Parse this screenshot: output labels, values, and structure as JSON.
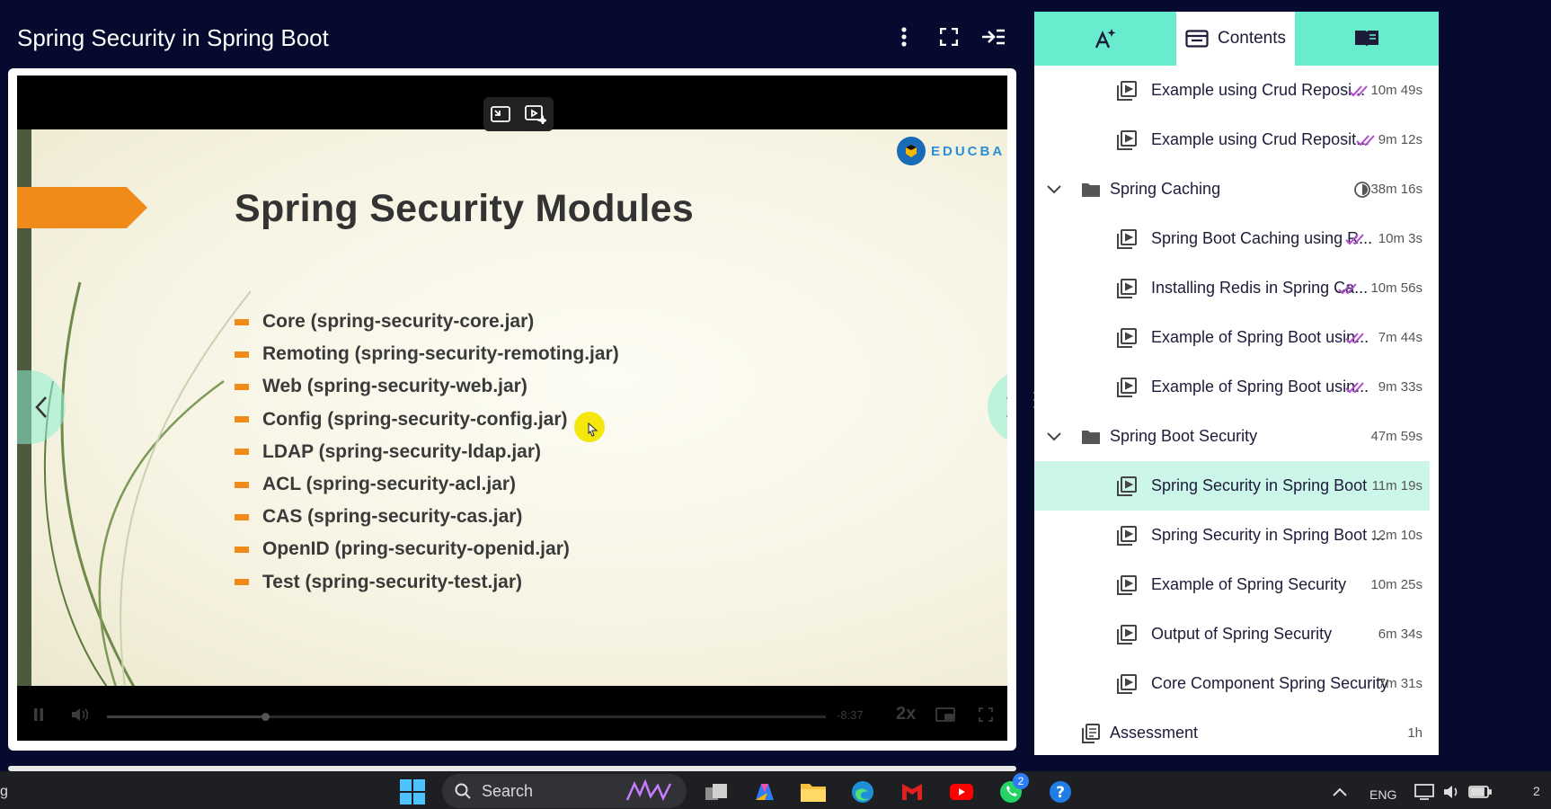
{
  "header": {
    "title": "Spring Security in Spring Boot"
  },
  "slide": {
    "heading": "Spring Security Modules",
    "logo_text": "EDUCBA",
    "modules": [
      "Core (spring-security-core.jar)",
      "Remoting (spring-security-remoting.jar)",
      "Web (spring-security-web.jar)",
      "Config (spring-security-config.jar)",
      "LDAP (spring-security-ldap.jar)",
      "ACL (spring-security-acl.jar)",
      "CAS (spring-security-cas.jar)",
      "OpenID (pring-security-openid.jar)",
      "Test (spring-security-test.jar)"
    ]
  },
  "player": {
    "time_remaining": "-8:37",
    "speed": "2x",
    "progress": 0.22
  },
  "sidebar": {
    "tabs": {
      "contents_label": "Contents"
    },
    "items": [
      {
        "type": "lesson",
        "label": "Example using Crud Reposi...",
        "duration": "10m 49s",
        "completed": true
      },
      {
        "type": "lesson",
        "label": "Example using Crud Reposit...",
        "duration": "9m 12s",
        "completed": true
      },
      {
        "type": "section",
        "label": "Spring Caching",
        "duration": "38m 16s",
        "partial": true
      },
      {
        "type": "lesson",
        "label": "Spring Boot Caching using R...",
        "duration": "10m 3s",
        "completed": true
      },
      {
        "type": "lesson",
        "label": "Installing Redis in Spring Ca...",
        "duration": "10m 56s",
        "completed": true
      },
      {
        "type": "lesson",
        "label": "Example of Spring Boot usin...",
        "duration": "7m 44s",
        "completed": true
      },
      {
        "type": "lesson",
        "label": "Example of Spring Boot usin...",
        "duration": "9m 33s",
        "completed": true
      },
      {
        "type": "section",
        "label": "Spring Boot Security",
        "duration": "47m 59s"
      },
      {
        "type": "lesson",
        "label": "Spring Security in Spring Boot",
        "duration": "11m 19s",
        "active": true
      },
      {
        "type": "lesson",
        "label": "Spring Security in Spring Boot ...",
        "duration": "12m 10s"
      },
      {
        "type": "lesson",
        "label": "Example of Spring Security",
        "duration": "10m 25s"
      },
      {
        "type": "lesson",
        "label": "Output of Spring Security",
        "duration": "6m 34s"
      },
      {
        "type": "lesson",
        "label": "Core Component Spring Security",
        "duration": "7m 31s"
      },
      {
        "type": "assessment",
        "label": "Assessment",
        "duration": "1h"
      }
    ]
  },
  "taskbar": {
    "left_text": "g",
    "search_placeholder": "Search",
    "whatsapp_badge": "2",
    "language": "ENG",
    "clock": "2"
  },
  "colors": {
    "accent": "#69ecce",
    "check": "#b04dc8",
    "background": "#050a2e",
    "slide_orange": "#f08a18"
  }
}
